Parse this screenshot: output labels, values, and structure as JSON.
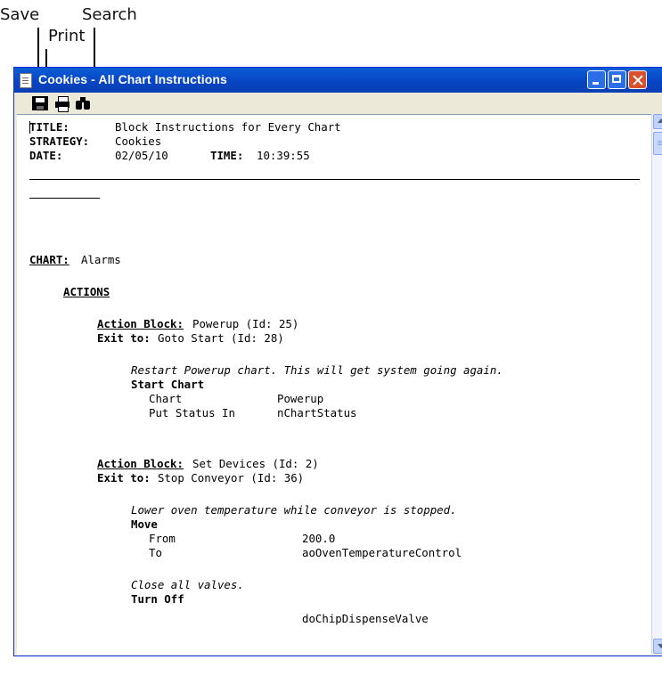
{
  "callouts": {
    "save": "Save",
    "print": "Print",
    "search": "Search"
  },
  "window": {
    "title": "Cookies - All Chart Instructions",
    "title_icon": "document-icon",
    "controls": [
      "minimize-icon",
      "maximize-icon",
      "close-icon"
    ]
  },
  "toolbar": {
    "icons": [
      "save-icon",
      "print-icon",
      "search-icon"
    ]
  },
  "header": {
    "title_label": "TITLE:",
    "title_value": "Block Instructions for Every Chart",
    "strategy_label": "STRATEGY:",
    "strategy_value": "Cookies",
    "date_label": "DATE:",
    "date_value": "02/05/10",
    "time_label": "TIME:",
    "time_value": "10:39:55"
  },
  "chart": {
    "label": "CHART:",
    "name": "Alarms",
    "actions_label": "ACTIONS"
  },
  "blocks": [
    {
      "action_label": "Action Block:",
      "action_value": "Powerup (Id: 25)",
      "exit_label": "Exit to:",
      "exit_value": "Goto Start (Id: 28)",
      "comment": "Restart Powerup chart. This will get system going again.",
      "instruction": "Start Chart",
      "params": [
        {
          "name": "Chart",
          "value": "Powerup"
        },
        {
          "name": "Put Status In",
          "value": "nChartStatus"
        }
      ]
    },
    {
      "action_label": "Action Block:",
      "action_value": "Set Devices (Id: 2)",
      "exit_label": "Exit to:",
      "exit_value": "Stop Conveyor (Id: 36)",
      "comment": "Lower oven temperature while conveyor is stopped.",
      "instruction": "Move",
      "params": [
        {
          "name": "From",
          "value": "200.0"
        },
        {
          "name": "To",
          "value": "aoOvenTemperatureControl"
        }
      ],
      "comment2": "Close all valves.",
      "instruction2": "Turn Off",
      "param2_value": "doChipDispenseValve"
    }
  ],
  "scrollbar": {
    "up": "scroll-up-arrow-icon",
    "down": "scroll-down-arrow-icon"
  }
}
